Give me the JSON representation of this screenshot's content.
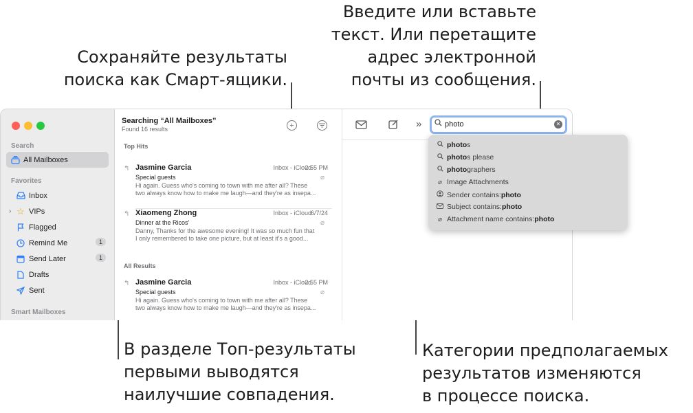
{
  "callouts": {
    "smart_mailbox": "Сохраняйте результаты\nпоиска как Смарт-ящики.",
    "search_field": "Введите или вставьте\nтекст. Или перетащите\nадрес электронной\nпочты из сообщения.",
    "top_hits": "В разделе Топ-результаты\nпервыми выводятся\nнаилучшие совпадения.",
    "suggestions": "Категории предполагаемых\nрезультатов изменяются\nв процессе поиска."
  },
  "sidebar": {
    "search_section": "Search",
    "search_item": "All Mailboxes",
    "favorites_section": "Favorites",
    "favorites": [
      {
        "label": "Inbox",
        "icon": "inbox-icon"
      },
      {
        "label": "VIPs",
        "icon": "star-icon"
      },
      {
        "label": "Flagged",
        "icon": "flag-icon"
      },
      {
        "label": "Remind Me",
        "icon": "clock-icon",
        "badge": "1"
      },
      {
        "label": "Send Later",
        "icon": "calendar-icon",
        "badge": "1"
      },
      {
        "label": "Drafts",
        "icon": "document-icon"
      },
      {
        "label": "Sent",
        "icon": "paper-plane-icon"
      }
    ],
    "smart_section": "Smart Mailboxes"
  },
  "list": {
    "title": "Searching “All Mailboxes”",
    "subtitle": "Found 16 results",
    "top_hits_label": "Top Hits",
    "all_results_label": "All Results",
    "top_hits": [
      {
        "from": "Jasmine Garcia",
        "mailbox": "Inbox - iCloud",
        "time": "2:55 PM",
        "subject": "Special guests",
        "preview": "Hi again. Guess who's coming to town with me after all? These\ntwo always know how to make me laugh—and they're as insepa..."
      },
      {
        "from": "Xiaomeng Zhong",
        "mailbox": "Inbox - iCloud",
        "time": "6/7/24",
        "subject": "Dinner at the Ricos'",
        "preview": "Danny, Thanks for the awesome evening! It was so much fun that\nI only remembered to take one picture, but at least it's a good..."
      }
    ],
    "all_results": [
      {
        "from": "Jasmine Garcia",
        "mailbox": "Inbox - iCloud",
        "time": "2:55 PM",
        "subject": "Special guests",
        "preview": "Hi again. Guess who's coming to town with me after all? These\ntwo always know how to make me laugh—and they're as insepa..."
      }
    ]
  },
  "search": {
    "value": "photo"
  },
  "suggestions": [
    {
      "icon": "search-icon",
      "match": "photo",
      "rest": "s",
      "prefix": ""
    },
    {
      "icon": "search-icon",
      "match": "photo",
      "rest": "s please",
      "prefix": ""
    },
    {
      "icon": "search-icon",
      "match": "photo",
      "rest": "graphers",
      "prefix": ""
    },
    {
      "icon": "paperclip-icon",
      "match": "",
      "rest": "",
      "prefix": "Image Attachments"
    },
    {
      "icon": "person-icon",
      "match": "photo",
      "rest": "",
      "prefix": "Sender contains: "
    },
    {
      "icon": "envelope-icon",
      "match": "photo",
      "rest": "",
      "prefix": "Subject contains: "
    },
    {
      "icon": "paperclip-icon",
      "match": "photo",
      "rest": "",
      "prefix": "Attachment name contains: "
    }
  ],
  "colors": {
    "accent": "#2d7ff9",
    "search_focus": "#8db4ef",
    "traffic_red": "#ff5f57",
    "traffic_yellow": "#febc2e",
    "traffic_green": "#28c840"
  }
}
